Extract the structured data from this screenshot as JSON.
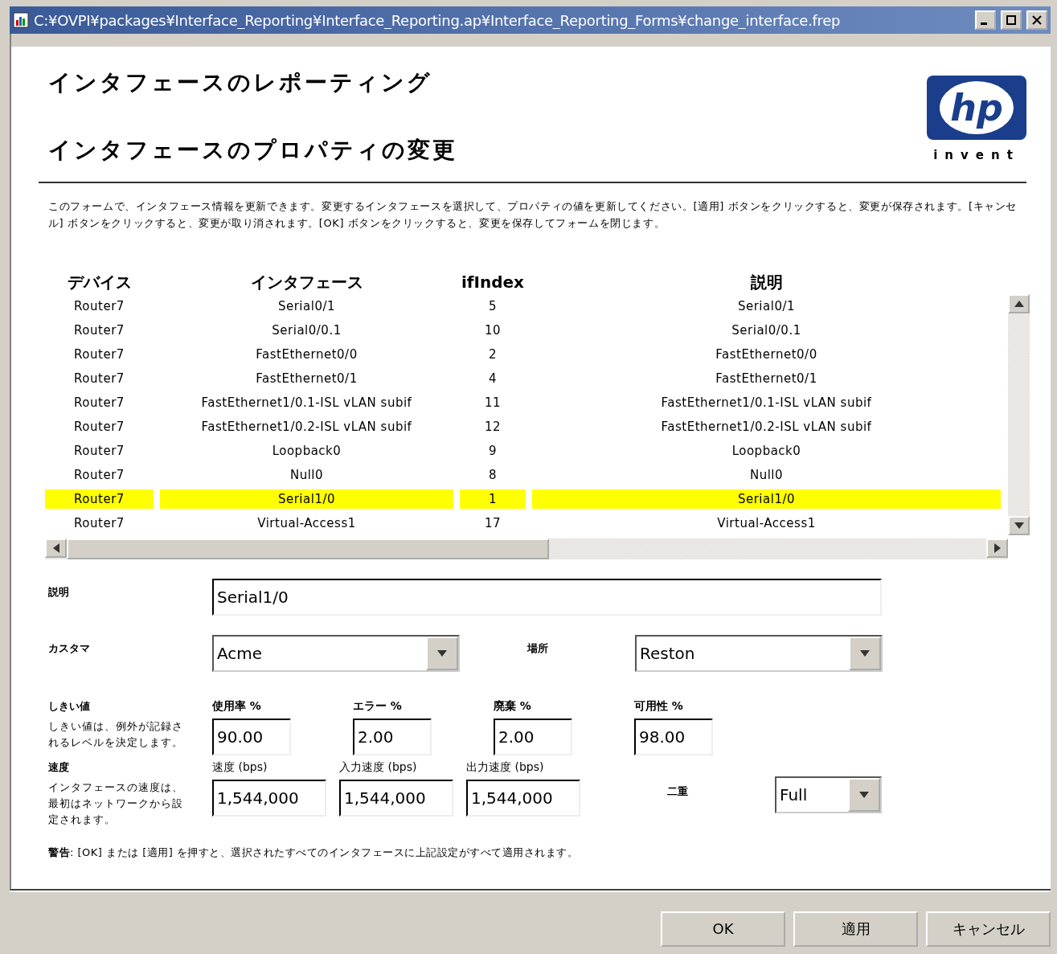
{
  "window": {
    "title": "C:¥OVPI¥packages¥Interface_Reporting¥Interface_Reporting.ap¥Interface_Reporting_Forms¥change_interface.frep"
  },
  "header": {
    "title": "インタフェースのレポーティング",
    "subtitle": "インタフェースのプロパティの変更",
    "logo": {
      "mark": "hp",
      "tagline": "invent"
    }
  },
  "intro": "このフォームで、インタフェース情報を更新できます。変更するインタフェースを選択して、プロパティの値を更新してください。[適用] ボタンをクリックすると、変更が保存されます。[キャンセル] ボタンをクリックすると、変更が取り消されます。[OK] ボタンをクリックすると、変更を保存してフォームを閉じます。",
  "table": {
    "columns": [
      "デバイス",
      "インタフェース",
      "ifIndex",
      "説明"
    ],
    "rows": [
      {
        "cells": [
          "Router7",
          "Serial0/1",
          "5",
          "Serial0/1"
        ],
        "selected": false
      },
      {
        "cells": [
          "Router7",
          "Serial0/0.1",
          "10",
          "Serial0/0.1"
        ],
        "selected": false
      },
      {
        "cells": [
          "Router7",
          "FastEthernet0/0",
          "2",
          "FastEthernet0/0"
        ],
        "selected": false
      },
      {
        "cells": [
          "Router7",
          "FastEthernet0/1",
          "4",
          "FastEthernet0/1"
        ],
        "selected": false
      },
      {
        "cells": [
          "Router7",
          "FastEthernet1/0.1-ISL vLAN subif",
          "11",
          "FastEthernet1/0.1-ISL vLAN subif"
        ],
        "selected": false
      },
      {
        "cells": [
          "Router7",
          "FastEthernet1/0.2-ISL vLAN subif",
          "12",
          "FastEthernet1/0.2-ISL vLAN subif"
        ],
        "selected": false
      },
      {
        "cells": [
          "Router7",
          "Loopback0",
          "9",
          "Loopback0"
        ],
        "selected": false
      },
      {
        "cells": [
          "Router7",
          "Null0",
          "8",
          "Null0"
        ],
        "selected": false
      },
      {
        "cells": [
          "Router7",
          "Serial1/0",
          "1",
          "Serial1/0"
        ],
        "selected": true
      },
      {
        "cells": [
          "Router7",
          "Virtual-Access1",
          "17",
          "Virtual-Access1"
        ],
        "selected": false
      }
    ]
  },
  "form": {
    "description": {
      "label": "説明",
      "value": "Serial1/0"
    },
    "customer": {
      "label": "カスタマ",
      "value": "Acme"
    },
    "location": {
      "label": "場所",
      "value": "Reston"
    },
    "thresholds": {
      "label": "しきい値",
      "help": "しきい値は、例外が記録されるレベルを決定します。",
      "fields": [
        {
          "label": "使用率 %",
          "value": "90.00"
        },
        {
          "label": "エラー %",
          "value": "2.00"
        },
        {
          "label": "廃棄 %",
          "value": "2.00"
        },
        {
          "label": "可用性 %",
          "value": "98.00"
        }
      ]
    },
    "speed": {
      "label": "速度",
      "help": "インタフェースの速度は、最初はネットワークから設定されます。",
      "fields": [
        {
          "label": "速度 (bps)",
          "value": "1,544,000"
        },
        {
          "label": "入力速度 (bps)",
          "value": "1,544,000"
        },
        {
          "label": "出力速度 (bps)",
          "value": "1,544,000"
        }
      ]
    },
    "duplex": {
      "label": "二重",
      "value": "Full"
    },
    "warning": "**警告**: [OK] または [適用] を押すと、選択されたすべてのインタフェースに上記設定がすべて適用されます。"
  },
  "buttons": [
    "OK",
    "適用",
    "キャンセル"
  ]
}
